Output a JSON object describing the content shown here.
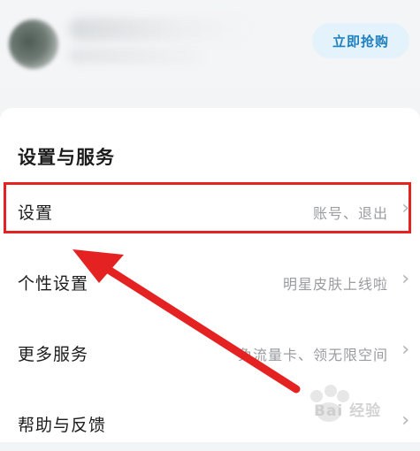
{
  "header": {
    "buy_button_label": "立即抢购"
  },
  "settings_section": {
    "title": "设置与服务",
    "items": [
      {
        "label": "设置",
        "value": "账号、退出"
      },
      {
        "label": "个性设置",
        "value": "明星皮肤上线啦"
      },
      {
        "label": "更多服务",
        "value": "免流量卡、领无限空间"
      },
      {
        "label": "帮助与反馈",
        "value": ""
      }
    ]
  },
  "annotation": {
    "highlight_color": "#e52222",
    "watermark_text": "Bai 经验"
  }
}
